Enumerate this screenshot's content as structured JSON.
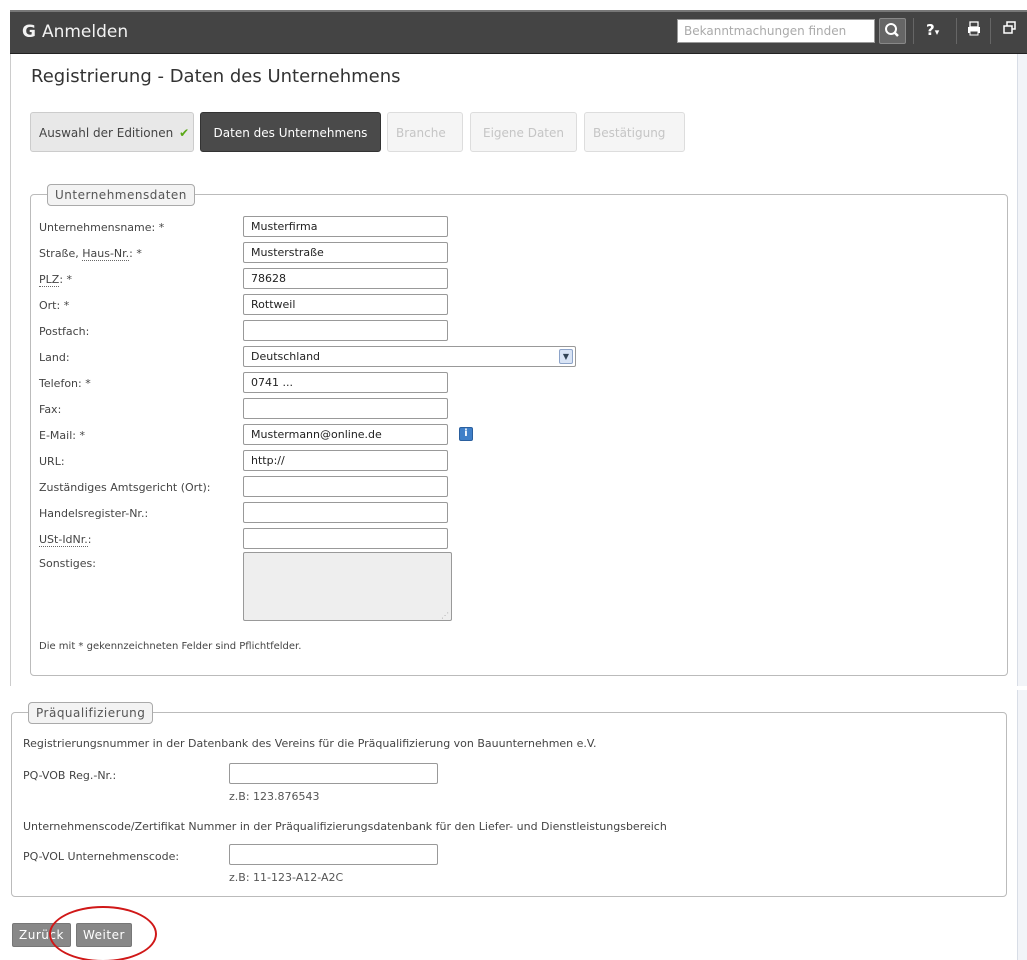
{
  "header": {
    "title": "Anmelden",
    "search_placeholder": "Bekanntmachungen finden",
    "help_label": "?",
    "icons": [
      "search-icon",
      "help-icon",
      "print-icon",
      "window-icon"
    ]
  },
  "page_title": "Registrierung - Daten des Unternehmens",
  "steps": [
    {
      "label": "Auswahl der Editionen",
      "state": "done"
    },
    {
      "label": "Daten des Unternehmens",
      "state": "active"
    },
    {
      "label": "Branche",
      "state": "disabled"
    },
    {
      "label": "Eigene Daten",
      "state": "disabled"
    },
    {
      "label": "Bestätigung",
      "state": "disabled"
    }
  ],
  "company": {
    "legend": "Unternehmensdaten",
    "fields": [
      {
        "label": "Unternehmensname: *",
        "value": ""
      },
      {
        "label_prefix": "Straße, ",
        "label_abbr": "Haus-Nr.",
        "label_suffix": ": *",
        "value": "Musterstraße"
      },
      {
        "label_abbr": "PLZ",
        "label_suffix": ": *",
        "value": "78628"
      },
      {
        "label": "Ort: *",
        "value": "Rottweil"
      },
      {
        "label": "Postfach:",
        "value": ""
      },
      {
        "label": "Land:",
        "value": "Deutschland"
      },
      {
        "label": "Telefon: *",
        "value": "0741 ..."
      },
      {
        "label": "Fax:",
        "value": ""
      },
      {
        "label": "E-Mail: *",
        "value": "Mustermann@online.de"
      },
      {
        "label": "URL:",
        "value": "http://"
      },
      {
        "label": "Zuständiges Amtsgericht (Ort):",
        "value": ""
      },
      {
        "label": "Handelsregister-Nr.:",
        "value": ""
      },
      {
        "label_abbr": "USt-IdNr.",
        "label_suffix": ":",
        "value": ""
      },
      {
        "label": "Sonstiges:",
        "value": ""
      }
    ],
    "company_name_value": "Musterfirma",
    "footnote": "Die mit * gekennzeichneten Felder sind Pflichtfelder."
  },
  "prequal": {
    "legend": "Präqualifizierung",
    "vob_text": "Registrierungsnummer in der Datenbank des Vereins für die Präqualifizierung von Bauunternehmen e.V.",
    "vob_label": "PQ-VOB Reg.-Nr.:",
    "vob_value": "",
    "vob_hint": "z.B: 123.876543",
    "vol_text": "Unternehmenscode/Zertifikat Nummer in der Präqualifizierungsdatenbank für den Liefer- und Dienstleistungsbereich",
    "vol_label": "PQ-VOL Unternehmenscode:",
    "vol_value": "",
    "vol_hint": "z.B: 11-123-A12-A2C"
  },
  "buttons": {
    "back": "Zurück",
    "next": "Weiter"
  }
}
